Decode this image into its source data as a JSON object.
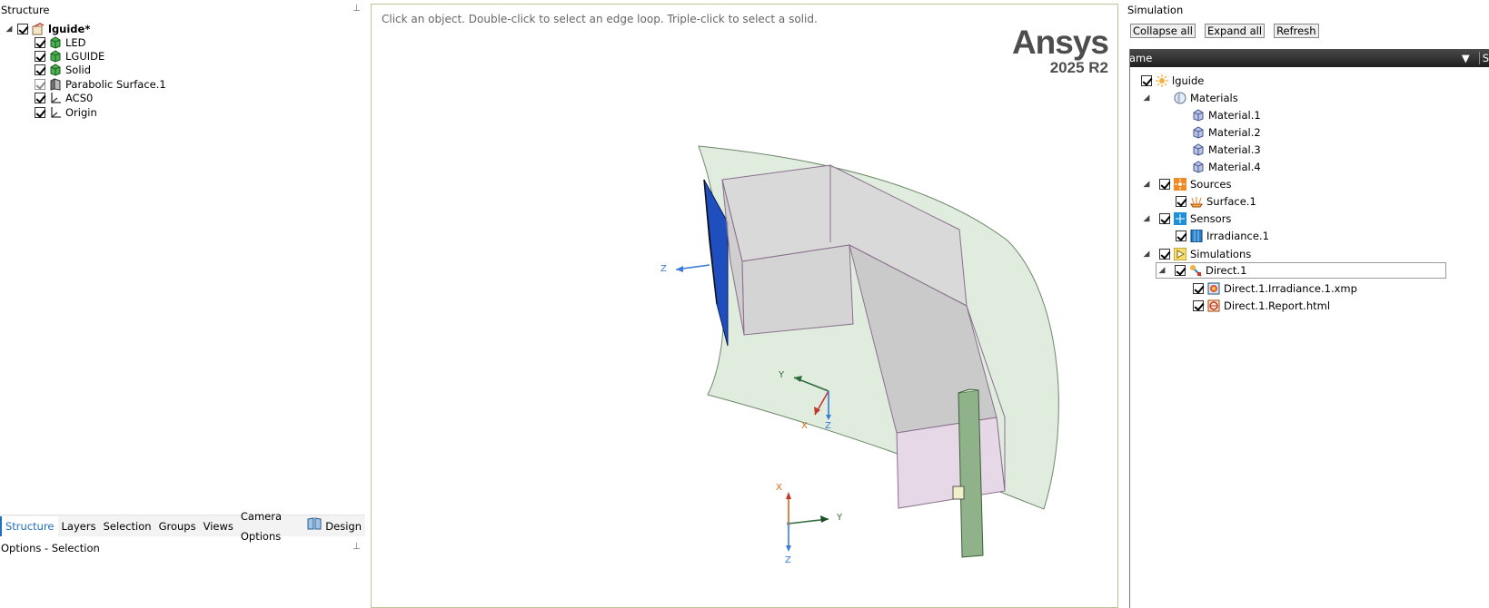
{
  "structure": {
    "title": "Structure",
    "root": {
      "label": "lguide*"
    },
    "items": [
      {
        "label": "LED"
      },
      {
        "label": "LGUIDE"
      },
      {
        "label": "Solid"
      },
      {
        "label": "Parabolic Surface.1"
      },
      {
        "label": "ACS0"
      },
      {
        "label": "Origin"
      }
    ]
  },
  "tabs": {
    "structure": "Structure",
    "layers": "Layers",
    "selection": "Selection",
    "groups": "Groups",
    "views": "Views",
    "camera_options": "Camera Options",
    "design": "Design"
  },
  "options": {
    "title": "Options - Selection"
  },
  "viewport": {
    "hint": "Click an object. Double-click to select an edge loop. Triple-click to select a solid.",
    "brand_name": "Ansys",
    "brand_version": "2025 R2",
    "axes": {
      "x": "X",
      "y": "Y",
      "z": "Z"
    }
  },
  "simulation": {
    "title": "Simulation",
    "buttons": {
      "collapse": "Collapse all",
      "expand": "Expand all",
      "refresh": "Refresh"
    },
    "column_name": "ame",
    "column_next": "S",
    "tree": {
      "root": "lguide",
      "materials": "Materials",
      "material_items": [
        "Material.1",
        "Material.2",
        "Material.3",
        "Material.4"
      ],
      "sources": "Sources",
      "surface": "Surface.1",
      "sensors": "Sensors",
      "irradiance": "Irradiance.1",
      "simulations": "Simulations",
      "direct": "Direct.1",
      "direct_xmp": "Direct.1.Irradiance.1.xmp",
      "direct_report": "Direct.1.Report.html"
    }
  },
  "colors": {
    "accent": "#1f6fbf",
    "part_green": "#3b9b3b",
    "surface_green": "#dceadb",
    "axis_x": "#d2691e",
    "axis_y": "#2e6b3a",
    "axis_z": "#3a7bd5"
  }
}
